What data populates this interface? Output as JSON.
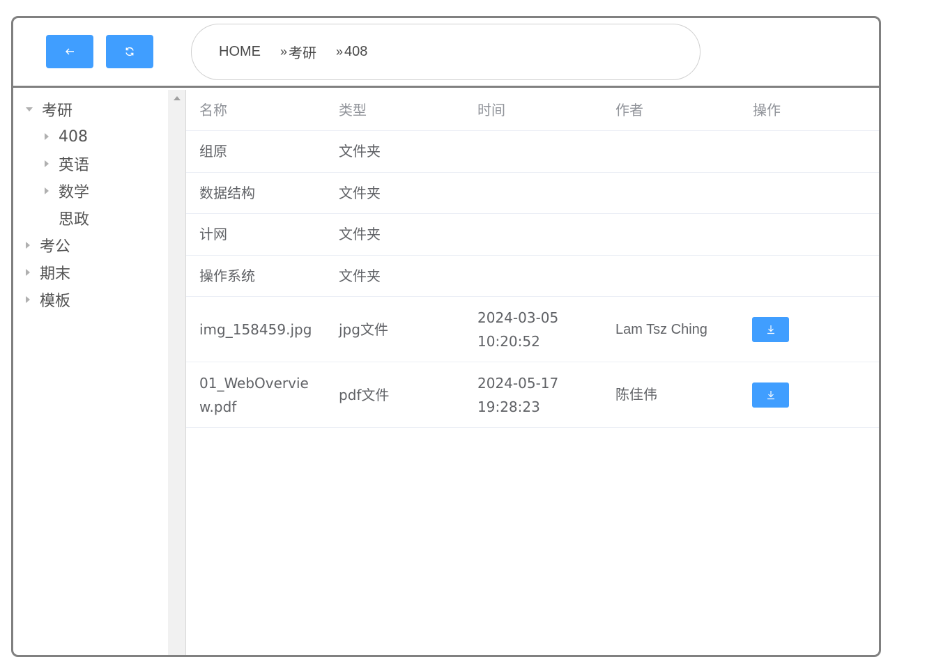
{
  "toolbar": {
    "back_icon": "arrow-left-icon",
    "refresh_icon": "refresh-icon"
  },
  "breadcrumb": {
    "items": [
      "HOME",
      "考研",
      "408"
    ],
    "separator": "»"
  },
  "tree": {
    "items": [
      {
        "label": "考研",
        "level": 0,
        "expanded": true
      },
      {
        "label": "408",
        "level": 1,
        "expanded": false
      },
      {
        "label": "英语",
        "level": 1,
        "expanded": false
      },
      {
        "label": "数学",
        "level": 1,
        "expanded": false
      },
      {
        "label": "思政",
        "level": 1,
        "leaf": true
      },
      {
        "label": "考公",
        "level": 0,
        "expanded": false
      },
      {
        "label": "期末",
        "level": 0,
        "expanded": false
      },
      {
        "label": "模板",
        "level": 0,
        "expanded": false
      }
    ]
  },
  "table": {
    "headers": [
      "名称",
      "类型",
      "时间",
      "作者",
      "操作"
    ],
    "rows": [
      {
        "name": "组原",
        "type": "文件夹",
        "time": "",
        "author": ""
      },
      {
        "name": "数据结构",
        "type": "文件夹",
        "time": "",
        "author": ""
      },
      {
        "name": "计网",
        "type": "文件夹",
        "time": "",
        "author": ""
      },
      {
        "name": "操作系统",
        "type": "文件夹",
        "time": "",
        "author": ""
      },
      {
        "name": "img_158459.jpg",
        "type": "jpg文件",
        "time": "2024-03-05 10:20:52",
        "author": "Lam Tsz Ching",
        "download": true
      },
      {
        "name": "01_WebOverview.pdf",
        "type": "pdf文件",
        "time": "2024-05-17 19:28:23",
        "author": "陈佳伟",
        "download": true
      }
    ]
  },
  "colors": {
    "accent": "#409eff",
    "border": "#808080"
  }
}
